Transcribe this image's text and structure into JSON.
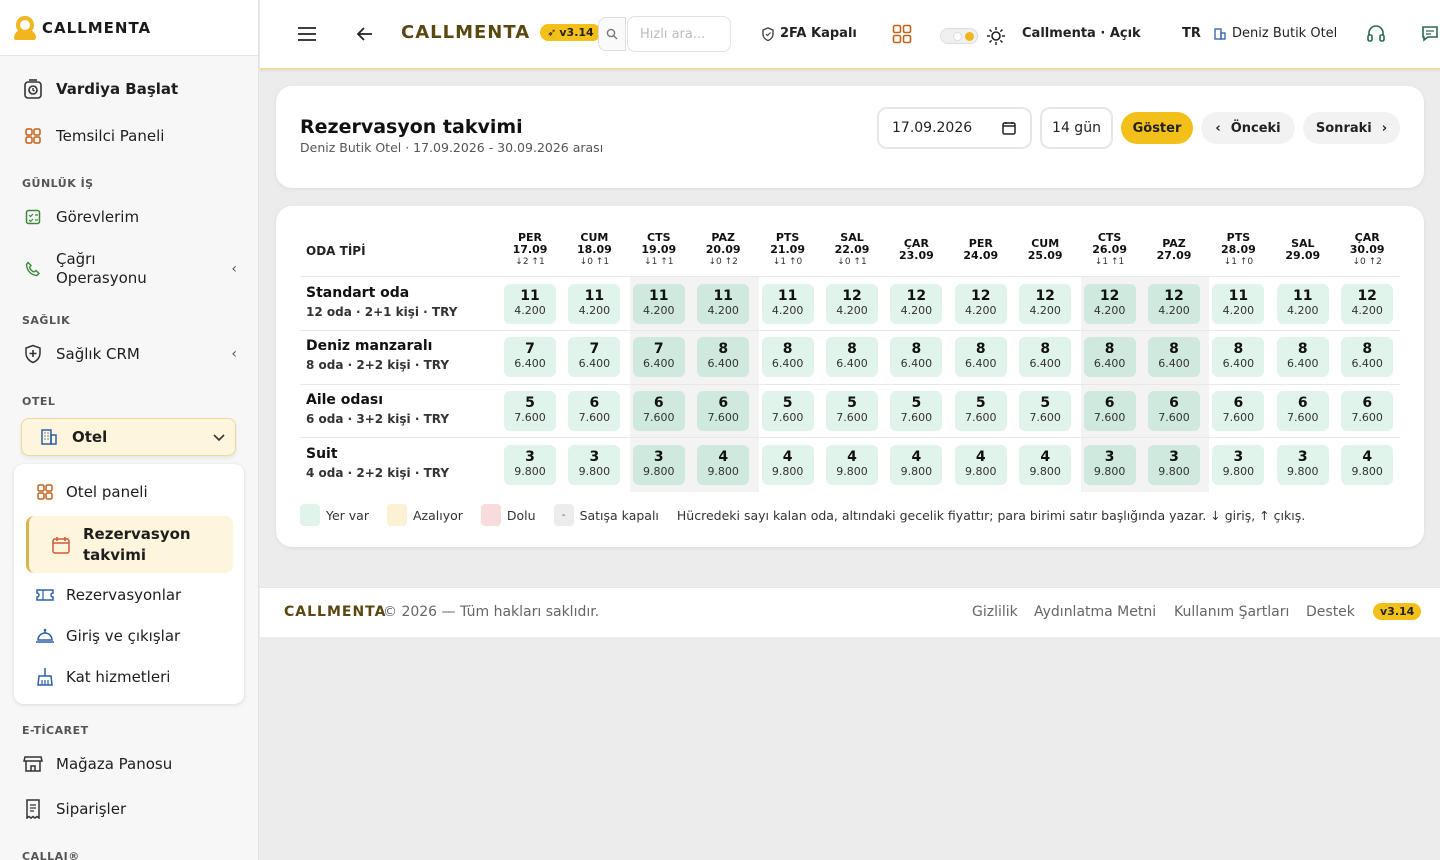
{
  "brand": {
    "name": "CALLMENTA"
  },
  "sidebar": {
    "top_items": [
      {
        "label": "Vardiya Başlat"
      },
      {
        "label": "Temsilci Paneli"
      }
    ],
    "sections": {
      "gunluk": "GÜNLÜK İŞ",
      "saglik": "SAĞLIK",
      "otel": "OTEL",
      "eticaret": "E-TİCARET",
      "callai": "CALLAI®"
    },
    "gunluk_items": [
      {
        "label": "Görevlerim"
      },
      {
        "label": "Çağrı Operasyonu"
      }
    ],
    "saglik_items": [
      {
        "label": "Sağlık CRM"
      }
    ],
    "otel_group": "Otel",
    "otel_items": [
      {
        "label": "Otel paneli"
      },
      {
        "label": "Rezervasyon takvimi"
      },
      {
        "label": "Rezervasyonlar"
      },
      {
        "label": "Giriş ve çıkışlar"
      },
      {
        "label": "Kat hizmetleri"
      }
    ],
    "eticaret_items": [
      {
        "label": "Mağaza Panosu"
      },
      {
        "label": "Siparişler"
      }
    ]
  },
  "topbar": {
    "title": "CALLMENTA",
    "version": "v3.14",
    "search_placeholder": "Hızlı ara...",
    "twofa": "2FA Kapalı",
    "status": "Callmenta · Açık",
    "lang": "TR",
    "hotel": "Deniz Butik Otel"
  },
  "page": {
    "title": "Rezervasyon takvimi",
    "subtitle": "Deniz Butik Otel · 17.09.2026 - 30.09.2026 arası",
    "date_value": "17.09.2026",
    "days_value": "14 gün",
    "show_btn": "Göster",
    "prev_btn": "Önceki",
    "next_btn": "Sonraki"
  },
  "calendar": {
    "room_header": "ODA TİPİ",
    "days": [
      {
        "day": "PER",
        "date": "17.09",
        "io": "↓2 ↑1",
        "weekend": false
      },
      {
        "day": "CUM",
        "date": "18.09",
        "io": "↓0 ↑1",
        "weekend": false
      },
      {
        "day": "CTS",
        "date": "19.09",
        "io": "↓1 ↑1",
        "weekend": true
      },
      {
        "day": "PAZ",
        "date": "20.09",
        "io": "↓0 ↑2",
        "weekend": true
      },
      {
        "day": "PTS",
        "date": "21.09",
        "io": "↓1 ↑0",
        "weekend": false
      },
      {
        "day": "SAL",
        "date": "22.09",
        "io": "↓0 ↑1",
        "weekend": false
      },
      {
        "day": "ÇAR",
        "date": "23.09",
        "io": "",
        "weekend": false
      },
      {
        "day": "PER",
        "date": "24.09",
        "io": "",
        "weekend": false
      },
      {
        "day": "CUM",
        "date": "25.09",
        "io": "",
        "weekend": false
      },
      {
        "day": "CTS",
        "date": "26.09",
        "io": "↓1 ↑1",
        "weekend": true
      },
      {
        "day": "PAZ",
        "date": "27.09",
        "io": "",
        "weekend": true
      },
      {
        "day": "PTS",
        "date": "28.09",
        "io": "↓1 ↑0",
        "weekend": false
      },
      {
        "day": "SAL",
        "date": "29.09",
        "io": "",
        "weekend": false
      },
      {
        "day": "ÇAR",
        "date": "30.09",
        "io": "↓0 ↑2",
        "weekend": false
      }
    ],
    "rooms": [
      {
        "name": "Standart oda",
        "meta": "12 oda · 2+1 kişi · TRY",
        "price": "4.200",
        "counts": [
          11,
          11,
          11,
          11,
          11,
          12,
          12,
          12,
          12,
          12,
          12,
          11,
          11,
          12
        ]
      },
      {
        "name": "Deniz manzaralı",
        "meta": "8 oda · 2+2 kişi · TRY",
        "price": "6.400",
        "counts": [
          7,
          7,
          7,
          8,
          8,
          8,
          8,
          8,
          8,
          8,
          8,
          8,
          8,
          8
        ]
      },
      {
        "name": "Aile odası",
        "meta": "6 oda · 3+2 kişi · TRY",
        "price": "7.600",
        "counts": [
          5,
          6,
          6,
          6,
          5,
          5,
          5,
          5,
          5,
          6,
          6,
          6,
          6,
          6
        ]
      },
      {
        "name": "Suit",
        "meta": "4 oda · 2+2 kişi · TRY",
        "price": "9.800",
        "counts": [
          3,
          3,
          3,
          4,
          4,
          4,
          4,
          4,
          4,
          3,
          3,
          3,
          3,
          4
        ]
      }
    ],
    "legend": [
      {
        "label": "Yer var",
        "color": "#e1f4ec",
        "mark": ""
      },
      {
        "label": "Azalıyor",
        "color": "#fdf1d3",
        "mark": ""
      },
      {
        "label": "Dolu",
        "color": "#f8dcdc",
        "mark": ""
      },
      {
        "label": "Satışa kapalı",
        "color": "#ececec",
        "mark": "-"
      }
    ],
    "note": "Hücredeki sayı kalan oda, altındaki gecelik fiyattır; para birimi satır başlığında yazar. ↓ giriş, ↑ çıkış."
  },
  "footer": {
    "brand": "CALLMENTA",
    "copy": "© 2026 — Tüm hakları saklıdır.",
    "links": [
      "Gizlilik",
      "Aydınlatma Metni",
      "Kullanım Şartları",
      "Destek"
    ],
    "version": "v3.14"
  },
  "colors": {
    "accent": "#f2c019",
    "cell": "#e1f4ec",
    "cell_weekend": "#cfe9df",
    "active_bg": "#fdf6dd"
  }
}
